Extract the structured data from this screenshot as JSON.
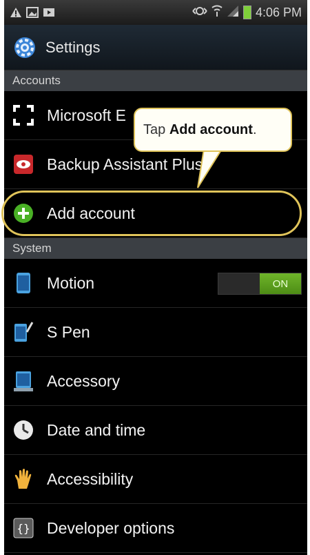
{
  "status_bar": {
    "time": "4:06 PM"
  },
  "header": {
    "title": "Settings"
  },
  "sections": {
    "accounts": "Accounts",
    "system": "System"
  },
  "accounts": [
    {
      "label": "Microsoft E",
      "icon": "exchange-icon"
    },
    {
      "label": "Backup Assistant Plus",
      "icon": "backup-icon"
    },
    {
      "label": "Add account",
      "icon": "plus-icon"
    }
  ],
  "system": [
    {
      "label": "Motion",
      "icon": "motion-icon",
      "toggle": "ON"
    },
    {
      "label": "S Pen",
      "icon": "pen-icon"
    },
    {
      "label": "Accessory",
      "icon": "accessory-icon"
    },
    {
      "label": "Date and time",
      "icon": "clock-icon"
    },
    {
      "label": "Accessibility",
      "icon": "hand-icon"
    },
    {
      "label": "Developer options",
      "icon": "braces-icon"
    }
  ],
  "callout": {
    "prefix": "Tap ",
    "bold": "Add account",
    "suffix": "."
  },
  "colors": {
    "highlight": "#e0c45a",
    "toggle_on": "#5fa11f"
  }
}
